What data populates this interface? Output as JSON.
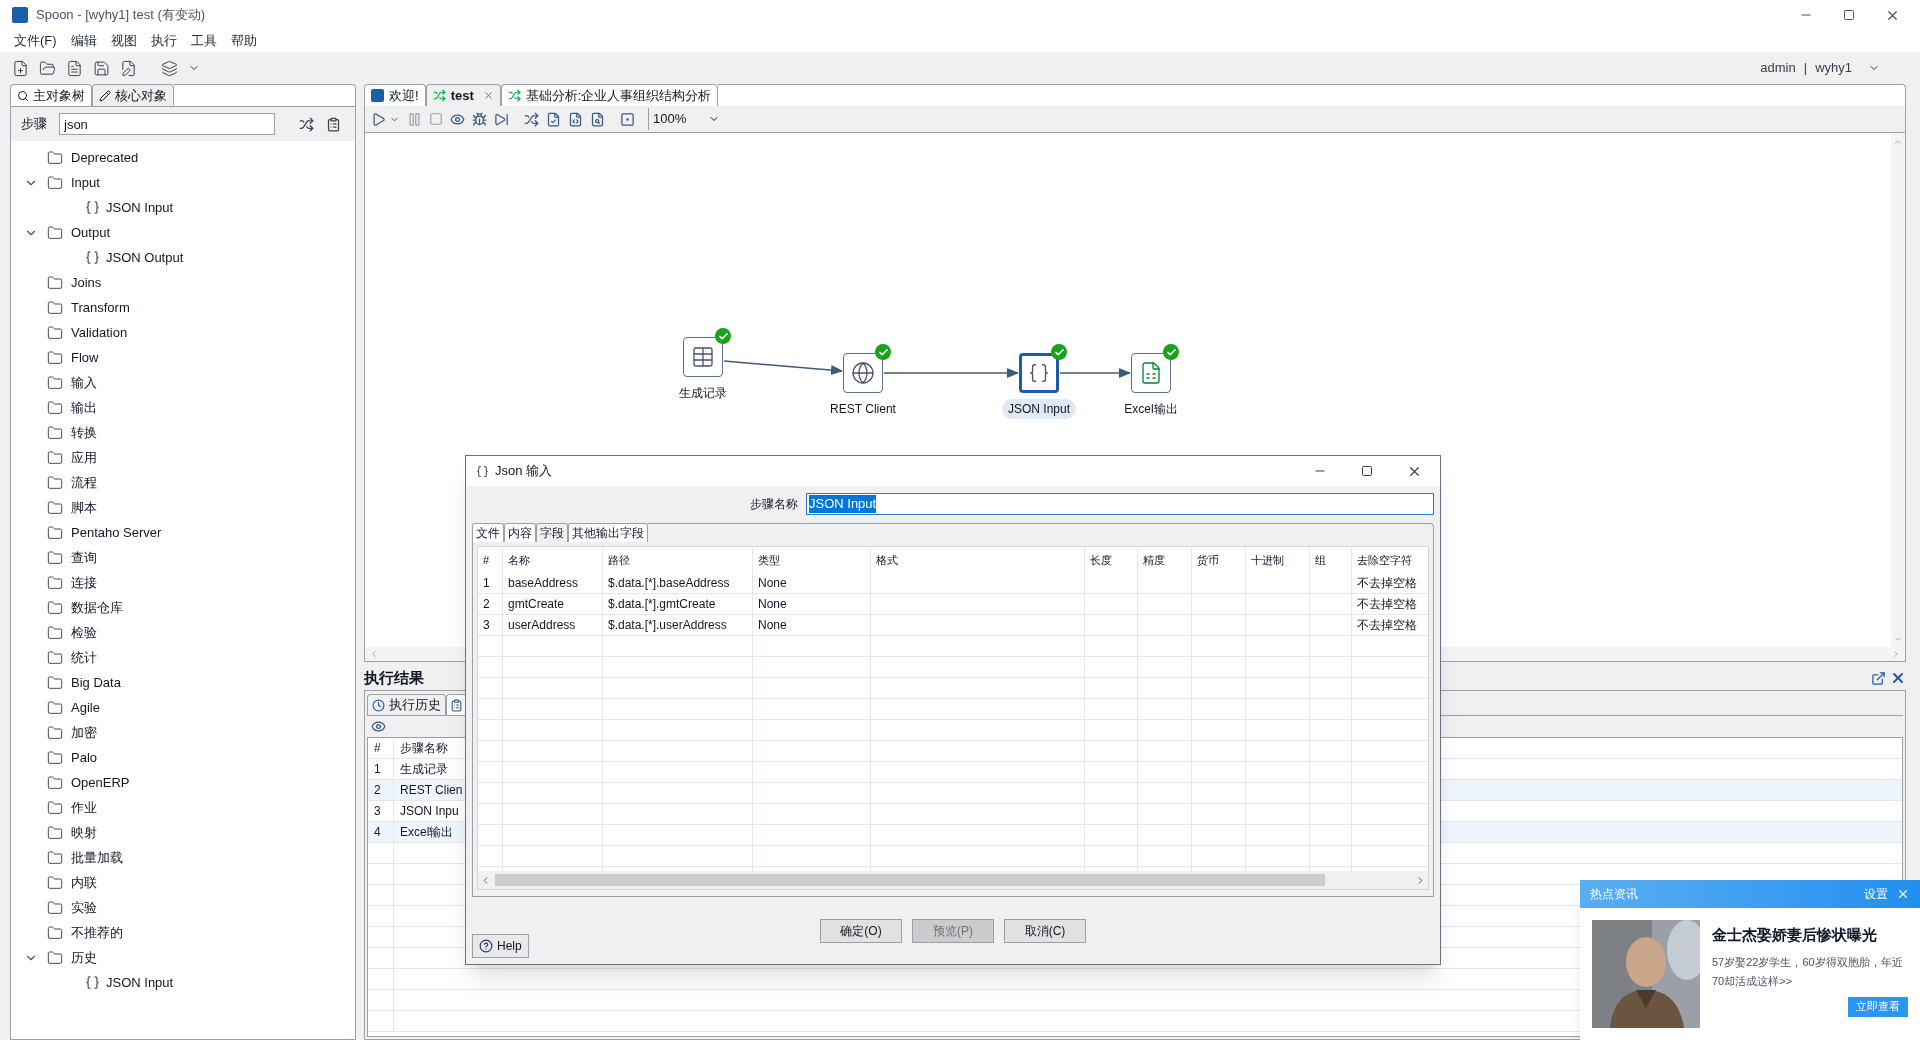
{
  "window": {
    "title": "Spoon - [wyhy1] test (有变动)"
  },
  "menu": [
    "文件(F)",
    "编辑",
    "视图",
    "执行",
    "工具",
    "帮助"
  ],
  "user": {
    "name": "admin",
    "separator": "|",
    "repo": "wyhy1"
  },
  "left_tabs": [
    {
      "label": "主对象树",
      "selected": false,
      "kind": "tree"
    },
    {
      "label": "核心对象",
      "selected": true,
      "kind": "pencil"
    }
  ],
  "step_search": {
    "label": "步骤",
    "value": "json"
  },
  "tree": [
    {
      "label": "Deprecated",
      "expanded": false
    },
    {
      "label": "Input",
      "expanded": true,
      "children": [
        {
          "label": "JSON Input"
        }
      ]
    },
    {
      "label": "Output",
      "expanded": true,
      "children": [
        {
          "label": "JSON Output"
        }
      ]
    },
    {
      "label": "Joins",
      "expanded": false
    },
    {
      "label": "Transform",
      "expanded": false
    },
    {
      "label": "Validation",
      "expanded": false
    },
    {
      "label": "Flow",
      "expanded": false
    },
    {
      "label": "输入",
      "expanded": false
    },
    {
      "label": "输出",
      "expanded": false
    },
    {
      "label": "转换",
      "expanded": false
    },
    {
      "label": "应用",
      "expanded": false
    },
    {
      "label": "流程",
      "expanded": false
    },
    {
      "label": "脚本",
      "expanded": false
    },
    {
      "label": "Pentaho Server",
      "expanded": false
    },
    {
      "label": "查询",
      "expanded": false
    },
    {
      "label": "连接",
      "expanded": false
    },
    {
      "label": "数据仓库",
      "expanded": false
    },
    {
      "label": "检验",
      "expanded": false
    },
    {
      "label": "统计",
      "expanded": false
    },
    {
      "label": "Big Data",
      "expanded": false
    },
    {
      "label": "Agile",
      "expanded": false
    },
    {
      "label": "加密",
      "expanded": false
    },
    {
      "label": "Palo",
      "expanded": false
    },
    {
      "label": "OpenERP",
      "expanded": false
    },
    {
      "label": "作业",
      "expanded": false
    },
    {
      "label": "映射",
      "expanded": false
    },
    {
      "label": "批量加载",
      "expanded": false
    },
    {
      "label": "内联",
      "expanded": false
    },
    {
      "label": "实验",
      "expanded": false
    },
    {
      "label": "不推荐的",
      "expanded": false
    },
    {
      "label": "历史",
      "expanded": true,
      "children": [
        {
          "label": "JSON Input"
        }
      ]
    }
  ],
  "editor_tabs": [
    {
      "label": "欢迎!",
      "selected": false,
      "closable": false,
      "kind": "welcome"
    },
    {
      "label": "test",
      "selected": true,
      "closable": true,
      "kind": "transform"
    },
    {
      "label": "基础分析:企业人事组织结构分析",
      "selected": false,
      "closable": false,
      "kind": "transform"
    }
  ],
  "zoom": "100%",
  "canvas": {
    "nodes": [
      {
        "label": "生成记录",
        "kind": "generator",
        "selected": false,
        "ok": true
      },
      {
        "label": "REST Client",
        "kind": "rest",
        "selected": false,
        "ok": true
      },
      {
        "label": "JSON Input",
        "kind": "json",
        "selected": true,
        "ok": true
      },
      {
        "label": "Excel输出",
        "kind": "excel",
        "selected": false,
        "ok": true
      }
    ]
  },
  "results": {
    "title": "执行结果",
    "tabs": [
      {
        "label": "执行历史",
        "selected": true
      }
    ],
    "columns": [
      "#",
      "步骤名称"
    ],
    "rows": [
      [
        "1",
        "生成记录"
      ],
      [
        "2",
        "REST Clien"
      ],
      [
        "3",
        "JSON Inpu"
      ],
      [
        "4",
        "Excel输出"
      ]
    ]
  },
  "dialog": {
    "title": "Json 输入",
    "step_name_label": "步骤名称",
    "step_name": "JSON Input",
    "tabs": [
      {
        "label": "文件",
        "selected": false
      },
      {
        "label": "内容",
        "selected": false
      },
      {
        "label": "字段",
        "selected": true
      },
      {
        "label": "其他输出字段",
        "selected": false
      }
    ],
    "columns": [
      "#",
      "名称",
      "路径",
      "类型",
      "格式",
      "长度",
      "精度",
      "货币",
      "十进制",
      "组",
      "去除空字符"
    ],
    "rows": [
      [
        "1",
        "baseAddress",
        "$.data.[*].baseAddress",
        "None",
        "",
        "",
        "",
        "",
        "",
        "",
        "不去掉空格"
      ],
      [
        "2",
        "gmtCreate",
        "$.data.[*].gmtCreate",
        "None",
        "",
        "",
        "",
        "",
        "",
        "",
        "不去掉空格"
      ],
      [
        "3",
        "userAddress",
        "$.data.[*].userAddress",
        "None",
        "",
        "",
        "",
        "",
        "",
        "",
        "不去掉空格"
      ]
    ],
    "help": "Help",
    "buttons": [
      {
        "label": "确定(O)",
        "disabled": false
      },
      {
        "label": "预览(P)",
        "disabled": true
      },
      {
        "label": "取消(C)",
        "disabled": false
      }
    ]
  },
  "popup": {
    "title": "热点资讯",
    "settings": "设置",
    "headline": "金士杰娶娇妻后惨状曝光",
    "body": "57岁娶22岁学生，60岁得双胞胎，年近70却活成这样>>",
    "button": "立即查看"
  }
}
